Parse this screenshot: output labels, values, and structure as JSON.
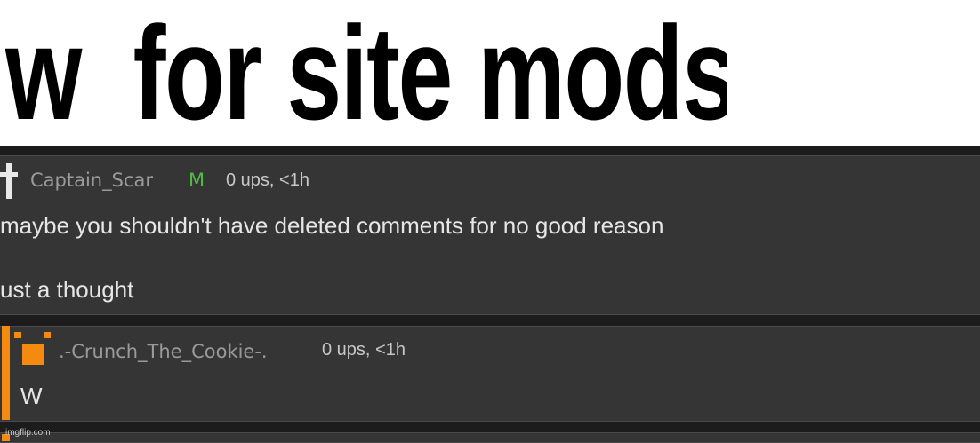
{
  "banner": {
    "title": "w  for site mods"
  },
  "comments": [
    {
      "username": "Captain_Scar",
      "badge": "M",
      "meta": "0 ups, <1h",
      "lines": [
        "maybe you shouldn't have deleted comments for no good reason",
        "ust a thought"
      ],
      "avatar_icon": "cross-icon"
    },
    {
      "username": ".-Crunch_The_Cookie-.",
      "meta": "0 ups, <1h",
      "lines": [
        "W"
      ],
      "avatar_icon": "cookie-pixel-icon"
    }
  ],
  "watermark": "imgflip.com",
  "colors": {
    "comment_bg": "#353535",
    "panel_bg": "#1c1c1c",
    "accent_stripe": "#f48a10",
    "mod_badge": "#4fbd3f",
    "username": "#9a9a9a"
  }
}
